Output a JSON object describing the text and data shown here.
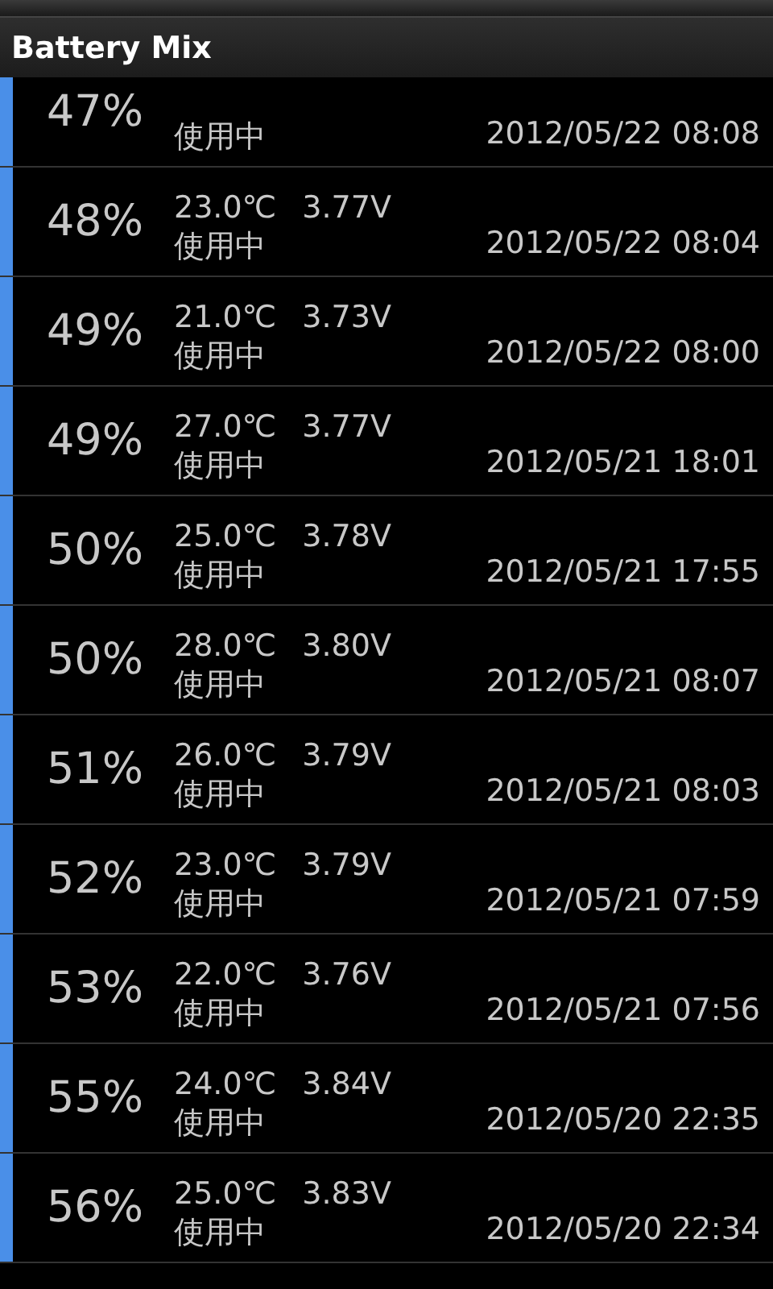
{
  "app_bar": {
    "title": "Battery Mix"
  },
  "records": [
    {
      "percent": "47%",
      "status": "使用中",
      "time": "2012/05/22 08:08"
    },
    {
      "percent": "48%",
      "temp": "23.0℃",
      "voltage": "3.77V",
      "status": "使用中",
      "time": "2012/05/22 08:04"
    },
    {
      "percent": "49%",
      "temp": "21.0℃",
      "voltage": "3.73V",
      "status": "使用中",
      "time": "2012/05/22 08:00"
    },
    {
      "percent": "49%",
      "temp": "27.0℃",
      "voltage": "3.77V",
      "status": "使用中",
      "time": "2012/05/21 18:01"
    },
    {
      "percent": "50%",
      "temp": "25.0℃",
      "voltage": "3.78V",
      "status": "使用中",
      "time": "2012/05/21 17:55"
    },
    {
      "percent": "50%",
      "temp": "28.0℃",
      "voltage": "3.80V",
      "status": "使用中",
      "time": "2012/05/21 08:07"
    },
    {
      "percent": "51%",
      "temp": "26.0℃",
      "voltage": "3.79V",
      "status": "使用中",
      "time": "2012/05/21 08:03"
    },
    {
      "percent": "52%",
      "temp": "23.0℃",
      "voltage": "3.79V",
      "status": "使用中",
      "time": "2012/05/21 07:59"
    },
    {
      "percent": "53%",
      "temp": "22.0℃",
      "voltage": "3.76V",
      "status": "使用中",
      "time": "2012/05/21 07:56"
    },
    {
      "percent": "55%",
      "temp": "24.0℃",
      "voltage": "3.84V",
      "status": "使用中",
      "time": "2012/05/20 22:35"
    },
    {
      "percent": "56%",
      "temp": "25.0℃",
      "voltage": "3.83V",
      "status": "使用中",
      "time": "2012/05/20 22:34"
    }
  ]
}
